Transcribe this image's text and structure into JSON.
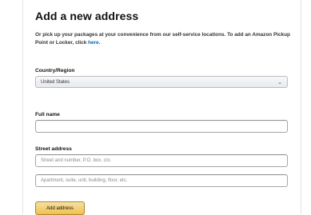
{
  "page": {
    "title": "Add a new address",
    "intro_text": "Or pick up your packages at your convenience from our self-service locations. To add an Amazon Pickup Point or Locker, click",
    "intro_link": "here",
    "intro_end": "."
  },
  "form": {
    "country_label": "Country/Region",
    "country_value": "United States",
    "fullname_label": "Full name",
    "fullname_value": "",
    "street_label": "Street address",
    "street1_placeholder": "Street and number, P.O. box, c/o.",
    "street2_placeholder": "Apartment, suite, unit, building, floor, etc.",
    "submit_label": "Add address"
  },
  "colors": {
    "link": "#0066c0",
    "button": "#f0c14b"
  }
}
